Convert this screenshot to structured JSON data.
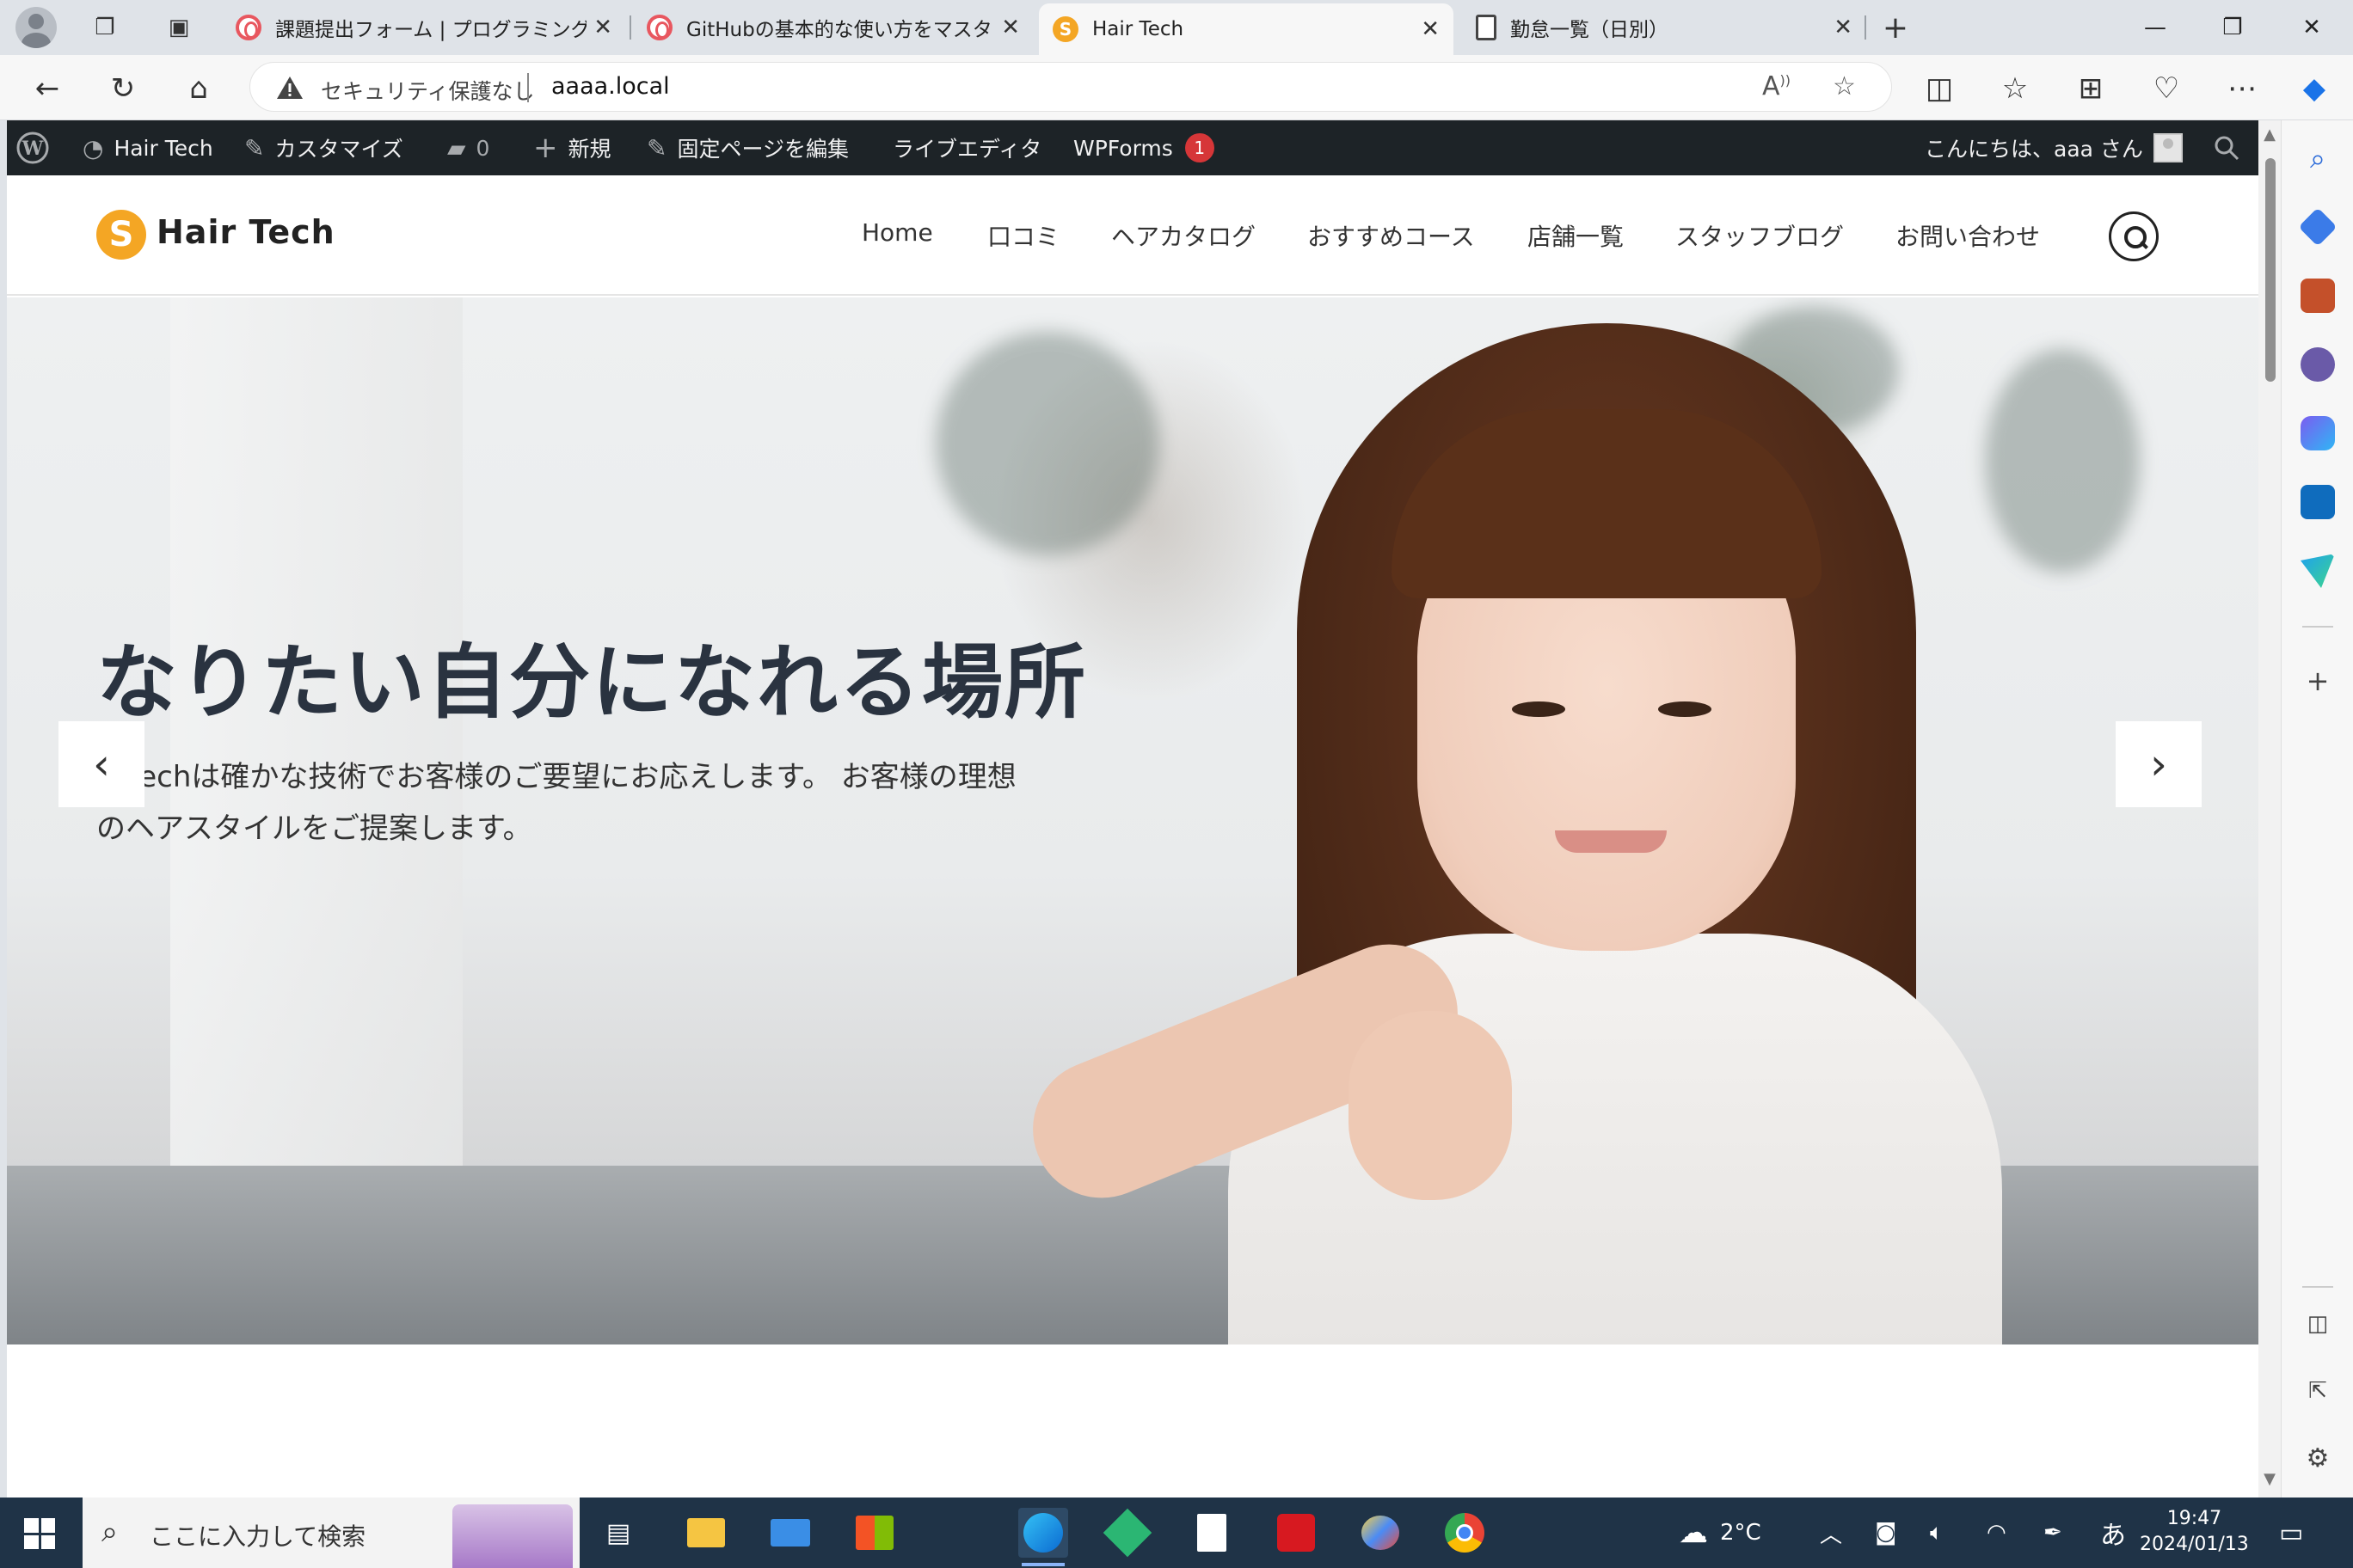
{
  "browser": {
    "tabs": [
      {
        "title": "課題提出フォーム | プログラミング学習",
        "favicon": "samurai-icon",
        "active": false
      },
      {
        "title": "GitHubの基本的な使い方をマスター",
        "favicon": "samurai-icon",
        "active": false
      },
      {
        "title": "Hair Tech",
        "favicon": "hairtech-icon",
        "active": true
      },
      {
        "title": "勤怠一覧（日別）",
        "favicon": "document-icon",
        "active": false
      }
    ],
    "close_glyph": "✕",
    "new_tab_glyph": "+",
    "address": {
      "security_text": "セキュリティ保護なし",
      "url": "aaaa.local"
    }
  },
  "wp_admin_bar": {
    "site_name": "Hair Tech",
    "customize": "カスタマイズ",
    "comments_count": "0",
    "new": "新規",
    "edit_page": "固定ページを編集",
    "live_editor": "ライブエディタ",
    "wpforms": "WPForms",
    "wpforms_badge": "1",
    "greeting": "こんにちは、aaa さん"
  },
  "site": {
    "logo_letter": "S",
    "logo_text": "Hair Tech",
    "menu": [
      "Home",
      "口コミ",
      "ヘアカタログ",
      "おすすめコース",
      "店舗一覧",
      "スタッフブログ",
      "お問い合わせ"
    ]
  },
  "hero": {
    "heading": "なりたい自分になれる場所",
    "lead_line1": "ir Techは確かな技術でお客様のご要望にお応えします。 お客様の理想",
    "lead_line2": "のヘアスタイルをご提案します。",
    "prev_glyph": "‹",
    "next_glyph": "›"
  },
  "taskbar": {
    "search_placeholder": "ここに入力して検索",
    "weather": "2°C",
    "ime": "あ",
    "time": "19:47",
    "date": "2024/01/13"
  },
  "colors": {
    "accent": "#f4a624",
    "wp_bar": "#1d2327",
    "badge": "#d63638",
    "taskbar": "#1f3347"
  }
}
